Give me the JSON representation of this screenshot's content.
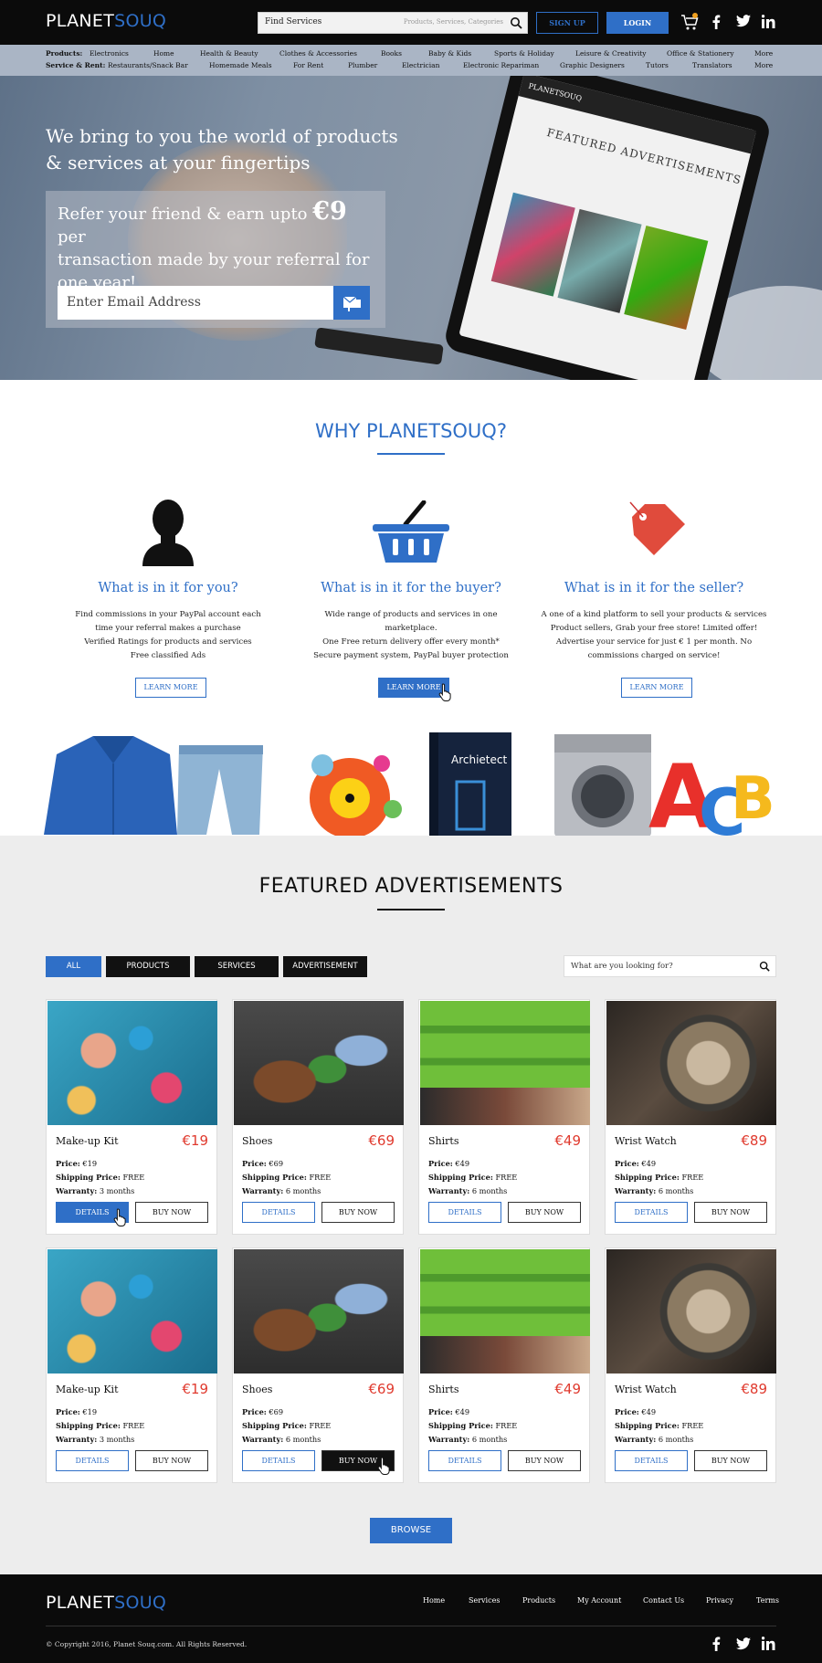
{
  "header": {
    "logo_part1": "PLANET",
    "logo_part2": "SOUQ",
    "search_value": "Find Services",
    "search_hint": "Products, Services, Categories",
    "signup_label": "SIGN UP",
    "login_label": "LOGIN",
    "cart_count": "",
    "social": [
      "facebook-icon",
      "twitter-icon",
      "linkedin-icon"
    ]
  },
  "nav": {
    "products_label": "Products:",
    "products": [
      "Electronics",
      "Home",
      "Health & Beauty",
      "Clothes &  Accessories",
      "Books",
      "Baby & Kids",
      "Sports & Holiday",
      "Leisure & Creativity",
      "Office & Stationery",
      "More"
    ],
    "services_label": "Service & Rent:",
    "services": [
      "Restaurants/Snack Bar",
      "Homemade Meals",
      "For Rent",
      "Plumber",
      "Electrician",
      "Electronic Repariman",
      "Graphic Designers",
      "Tutors",
      "Translators",
      "More"
    ]
  },
  "hero": {
    "headline_1": "We bring to you the world of products",
    "headline_2": "& services at your fingertips",
    "refer_1": "Refer your friend & earn upto",
    "refer_amount": "€9",
    "refer_2": "per",
    "refer_3": "transaction made by your referral for",
    "refer_4": "one year!",
    "email_placeholder": "Enter Email Address",
    "tablet_logo": "PLANETSOUQ",
    "tablet_title": "FEATURED ADVERTISEMENTS"
  },
  "why": {
    "title": "WHY PLANETSOUQ?",
    "columns": [
      {
        "icon": "user-silhouette-icon",
        "heading": "What is in it for you?",
        "lines": [
          "Find commissions in your PayPal account each",
          "time your referral makes a purchase",
          "Verified Ratings for products and services",
          "Free classified Ads"
        ],
        "button": "LEARN MORE"
      },
      {
        "icon": "shopping-basket-icon",
        "heading": "What is in it for the buyer?",
        "lines": [
          "Wide range of products and services in one",
          "marketplace.",
          "One Free return delivery offer every month*",
          "Secure payment system, PayPal buyer protection"
        ],
        "button": "LEARN MORE"
      },
      {
        "icon": "price-tag-icon",
        "heading": "What is in it for the seller?",
        "lines": [
          "A one of a kind platform to sell your products & services",
          "Product sellers, Grab your free store! Limited offer!",
          "Advertise your service for just € 1 per month. No",
          "commissions charged on service!"
        ],
        "button": "LEARN MORE"
      }
    ],
    "book_title": "Archietect"
  },
  "featured": {
    "title": "FEATURED ADVERTISEMENTS",
    "tabs": [
      "ALL",
      "PRODUCTS",
      "SERVICES",
      "ADVERTISEMENT"
    ],
    "search_placeholder": "What are you looking for?",
    "price_label": "Price:",
    "shipping_label": "Shipping Price:",
    "warranty_label": "Warranty:",
    "details_label": "DETAILS",
    "buy_label": "BUY NOW",
    "cards": [
      {
        "name": "Make-up Kit",
        "price": "€19",
        "price_small": "€19",
        "shipping": "FREE",
        "warranty": "3 months",
        "image": "makeup"
      },
      {
        "name": "Shoes",
        "price": "€69",
        "price_small": "€69",
        "shipping": "FREE",
        "warranty": "6 months",
        "image": "shoes"
      },
      {
        "name": "Shirts",
        "price": "€49",
        "price_small": "€49",
        "shipping": "FREE",
        "warranty": "6 months",
        "image": "shirts"
      },
      {
        "name": "Wrist Watch",
        "price": "€89",
        "price_small": "€49",
        "shipping": "FREE",
        "warranty": "6 months",
        "image": "watch"
      },
      {
        "name": "Make-up Kit",
        "price": "€19",
        "price_small": "€19",
        "shipping": "FREE",
        "warranty": "3 months",
        "image": "makeup"
      },
      {
        "name": "Shoes",
        "price": "€69",
        "price_small": "€69",
        "shipping": "FREE",
        "warranty": "6 months",
        "image": "shoes"
      },
      {
        "name": "Shirts",
        "price": "€49",
        "price_small": "€49",
        "shipping": "FREE",
        "warranty": "6 months",
        "image": "shirts"
      },
      {
        "name": "Wrist Watch",
        "price": "€89",
        "price_small": "€49",
        "shipping": "FREE",
        "warranty": "6 months",
        "image": "watch"
      }
    ],
    "browse_label": "BROWSE"
  },
  "footer": {
    "links": [
      "Home",
      "Services",
      "Products",
      "My Account",
      "Contact Us",
      "Privacy",
      "Terms"
    ],
    "copyright": "© Copyright 2016, Planet Souq.com. All Rights Reserved."
  },
  "colors": {
    "brand_blue": "#2f6fc7",
    "price_red": "#e03a2e",
    "dark": "#0b0b0b"
  }
}
